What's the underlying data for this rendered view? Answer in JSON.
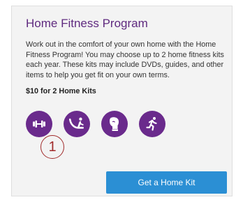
{
  "card": {
    "title": "Home Fitness Program",
    "description": "Work out in the comfort of your own home with the Home Fitness Program! You may choose up to 2 home fitness kits each year. These kits may include DVDs, guides, and other items to help you get fit on your own terms.",
    "price": "$10 for 2 Home Kits",
    "icons": [
      "dumbbell-icon",
      "yoga-pose-icon",
      "boxing-glove-icon",
      "running-person-icon"
    ],
    "cta_label": "Get a Home Kit"
  },
  "annotation": {
    "label": "1"
  },
  "colors": {
    "title": "#5f2a7f",
    "icon_background": "#6a2a8c",
    "button": "#2b8fd4",
    "annotation": "#a12b2b"
  }
}
